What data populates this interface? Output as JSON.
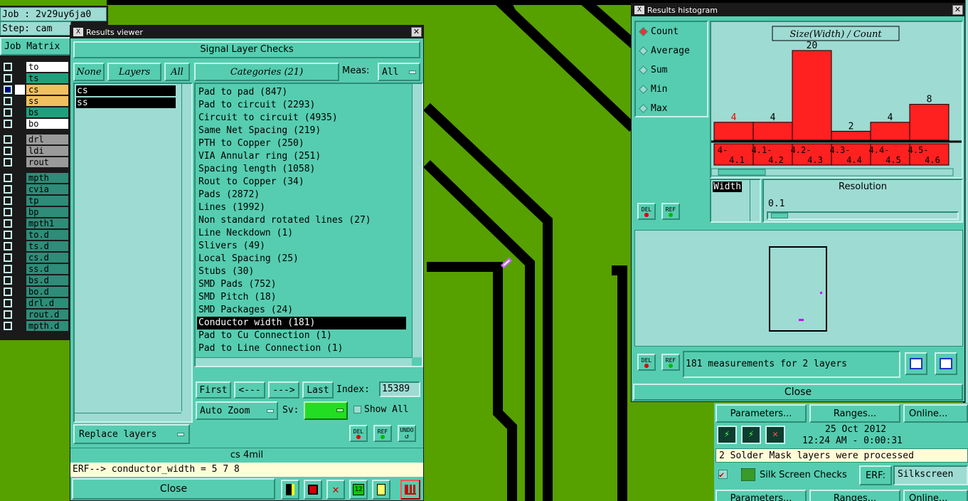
{
  "job_info": {
    "job": "Job : 2v29uy6ja0",
    "step": "Step: cam",
    "matrix_btn": "Job Matrix"
  },
  "layers": [
    {
      "name": "to",
      "color": "#000000"
    },
    {
      "name": "ts",
      "color": "#1fa07c"
    },
    {
      "name": "cs",
      "color": "#f0c060"
    },
    {
      "name": "ss",
      "color": "#f0c060"
    },
    {
      "name": "bs",
      "color": "#1fa07c"
    },
    {
      "name": "bo",
      "color": "#000000"
    },
    {
      "name": "drl",
      "color": "#9a9a9a"
    },
    {
      "name": "ldi",
      "color": "#9a9a9a"
    },
    {
      "name": "rout",
      "color": "#9a9a9a"
    },
    {
      "name": "mpth",
      "color": "#2e8c78"
    },
    {
      "name": "cvia",
      "color": "#2e8c78"
    },
    {
      "name": "tp",
      "color": "#2e8c78"
    },
    {
      "name": "bp",
      "color": "#2e8c78"
    },
    {
      "name": "mpth1",
      "color": "#2e8c78"
    },
    {
      "name": "to.d",
      "color": "#2e8c78"
    },
    {
      "name": "ts.d",
      "color": "#2e8c78"
    },
    {
      "name": "cs.d",
      "color": "#2e8c78"
    },
    {
      "name": "ss.d",
      "color": "#2e8c78"
    },
    {
      "name": "bs.d",
      "color": "#2e8c78"
    },
    {
      "name": "bo.d",
      "color": "#2e8c78"
    },
    {
      "name": "drl.d",
      "color": "#2e8c78"
    },
    {
      "name": "rout.d",
      "color": "#2e8c78"
    },
    {
      "name": "mpth.d",
      "color": "#2e8c78"
    }
  ],
  "results_viewer": {
    "title": "Results viewer",
    "header": "Signal Layer Checks",
    "none_btn": "None",
    "layers_btn": "Layers",
    "all_btn": "All",
    "layer_list": [
      "cs",
      "ss"
    ],
    "categories_btn": "Categories (21)",
    "meas_label": "Meas:",
    "meas_value": "All",
    "categories": [
      "Pad to pad (847)",
      "Pad to circuit (2293)",
      "Circuit to circuit (4935)",
      "Same Net Spacing (219)",
      "PTH to Copper (250)",
      "VIA Annular ring (251)",
      "Spacing length (1058)",
      "Rout to Copper (34)",
      "Pads (2872)",
      "Lines (1992)",
      "Non standard rotated lines (27)",
      "Line Neckdown (1)",
      "Slivers (49)",
      "Local Spacing (25)",
      "Stubs (30)",
      "SMD Pads (752)",
      "SMD Pitch (18)",
      "SMD Packages (24)",
      "Conductor width (181)",
      "Pad to Cu Connection (1)",
      "Pad to Line Connection (1)"
    ],
    "selected_category": "Conductor width (181)",
    "first_btn": "First",
    "prev_btn": "<---",
    "next_btn": "--->",
    "last_btn": "Last",
    "index_label": "Index:",
    "index_value": "15389",
    "auto_zoom": "Auto Zoom",
    "sv_label": "Sv:",
    "show_all": "Show All",
    "replace_layers": "Replace layers",
    "del": "DEL",
    "ref": "REF",
    "undo": "UNDO",
    "status_layer": "cs 4mil",
    "erf_line": "ERF--> conductor_width = 5 7 8",
    "close": "Close"
  },
  "histogram": {
    "title": "Results histogram",
    "modes": [
      "Count",
      "Average",
      "Sum",
      "Min",
      "Max"
    ],
    "selected_mode": "Count",
    "chart_title": "Size(Width) / Count",
    "width_label": "Width",
    "resolution_label": "Resolution",
    "resolution_value": "0.1",
    "del": "DEL",
    "ref": "REF",
    "summary": "181 measurements for 2 layers",
    "close": "Close"
  },
  "chart_data": {
    "type": "bar",
    "title": "Size(Width) / Count",
    "categories": [
      "4-4.1",
      "4.1-4.2",
      "4.2-4.3",
      "4.3-4.4",
      "4.4-4.5",
      "4.5-4.6"
    ],
    "category_lines": [
      [
        "4-",
        "4.1"
      ],
      [
        "4.1-",
        "4.2"
      ],
      [
        "4.2-",
        "4.3"
      ],
      [
        "4.3-",
        "4.4"
      ],
      [
        "4.4-",
        "4.5"
      ],
      [
        "4.5-",
        "4.6"
      ]
    ],
    "values": [
      4,
      4,
      20,
      2,
      4,
      8
    ],
    "value_label_colors": [
      "#ff0000",
      "#000000",
      "#000000",
      "#000000",
      "#000000",
      "#000000"
    ],
    "bar_color": "#ff2020",
    "ylim": [
      0,
      20
    ]
  },
  "lower_right": {
    "parameters": "Parameters...",
    "ranges": "Ranges...",
    "online": "Online...",
    "date": "25 Oct 2012",
    "time": "12:24 AM - 0:00:31",
    "message": "2 Solder Mask layers were processed",
    "silk_label": "Silk Screen Checks",
    "erf_label": "ERF:",
    "erf_value": "Silkscreen",
    "parameters2": "Parameters...",
    "ranges2": "Ranges...",
    "online2": "Online..."
  }
}
